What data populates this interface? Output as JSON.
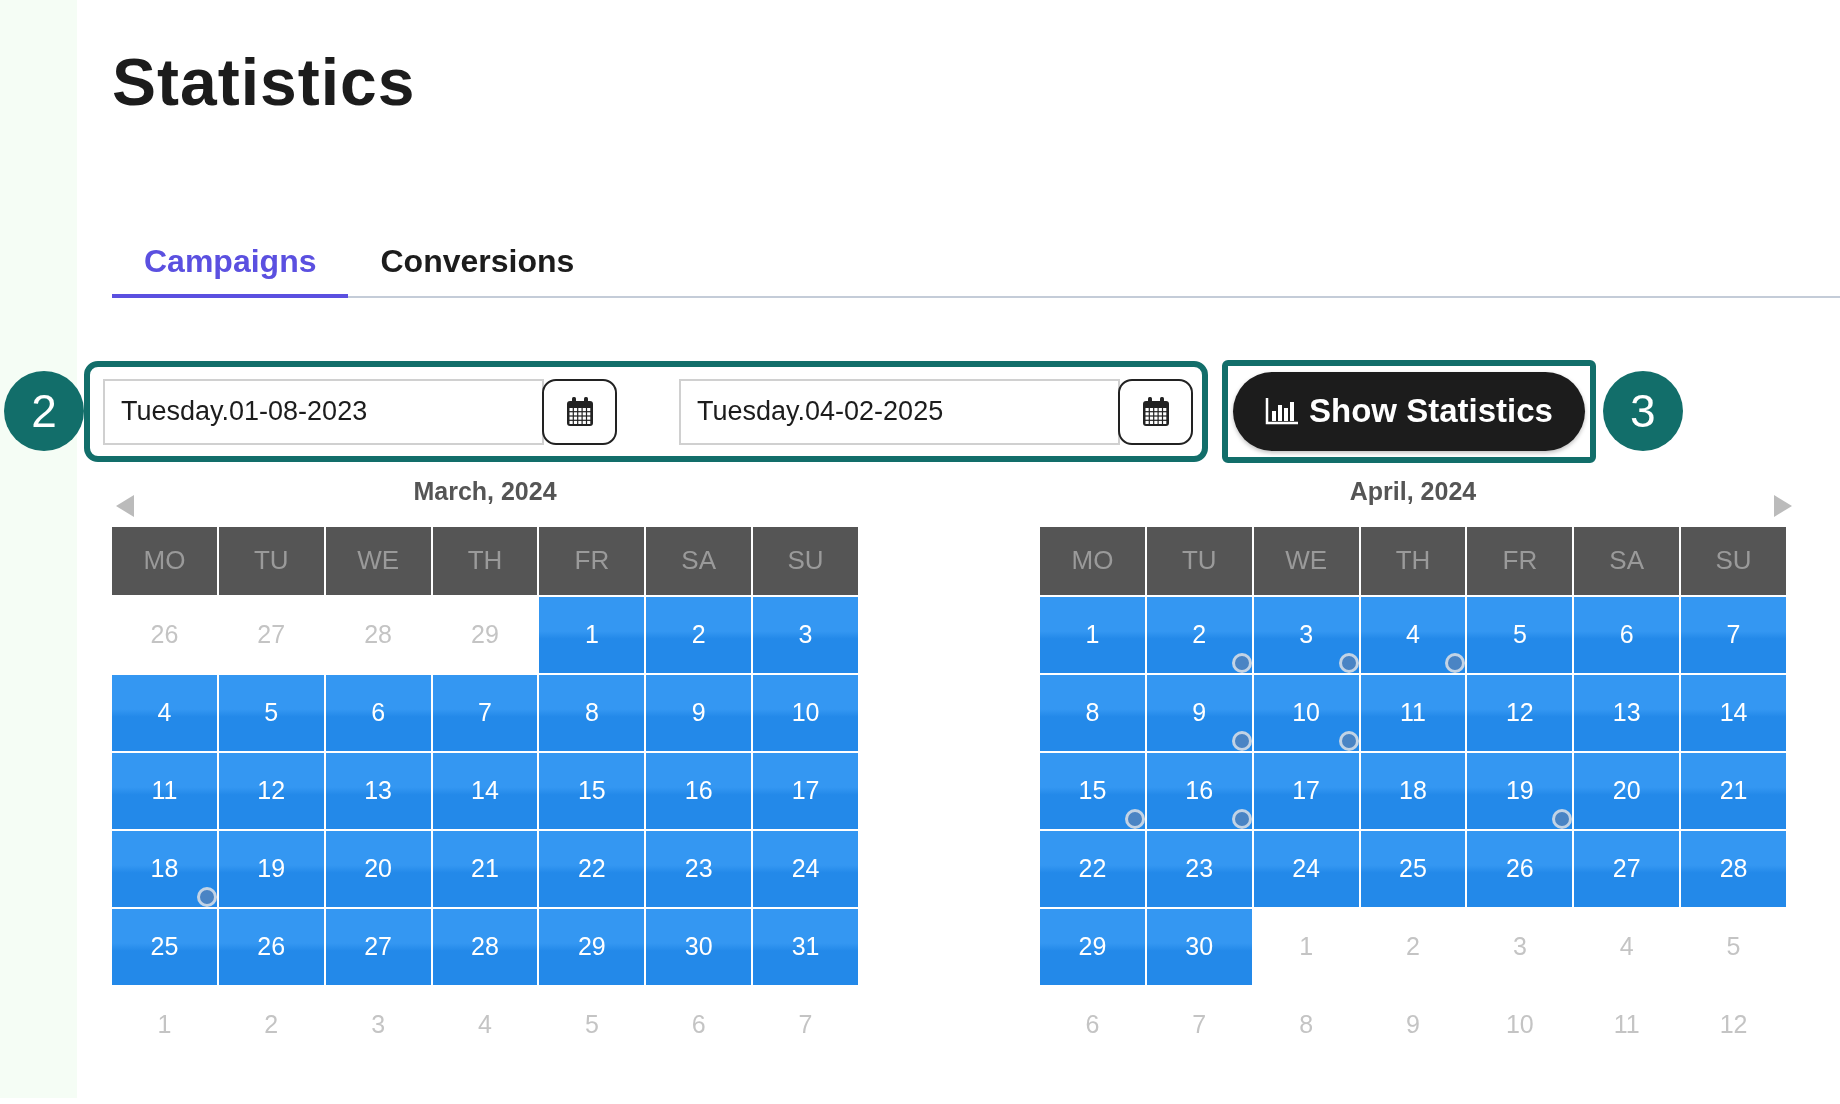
{
  "title": "Statistics",
  "tabs": [
    {
      "label": "Campaigns",
      "selected": true
    },
    {
      "label": "Conversions",
      "selected": false
    }
  ],
  "callouts": [
    "2",
    "3"
  ],
  "date_range": {
    "start": "Tuesday.01-08-2023",
    "end": "Tuesday.04-02-2025"
  },
  "show_button": "Show Statistics",
  "months": [
    {
      "title": "March, 2024",
      "prev_arrow": true,
      "next_arrow": false,
      "weekdays": [
        "MO",
        "TU",
        "WE",
        "TH",
        "FR",
        "SA",
        "SU"
      ],
      "weeks": [
        [
          {
            "label": "26",
            "selected": false,
            "marked": false
          },
          {
            "label": "27",
            "selected": false,
            "marked": false
          },
          {
            "label": "28",
            "selected": false,
            "marked": false
          },
          {
            "label": "29",
            "selected": false,
            "marked": false
          },
          {
            "label": "1",
            "selected": true,
            "marked": false
          },
          {
            "label": "2",
            "selected": true,
            "marked": false
          },
          {
            "label": "3",
            "selected": true,
            "marked": false
          }
        ],
        [
          {
            "label": "4",
            "selected": true,
            "marked": false
          },
          {
            "label": "5",
            "selected": true,
            "marked": false
          },
          {
            "label": "6",
            "selected": true,
            "marked": false
          },
          {
            "label": "7",
            "selected": true,
            "marked": false
          },
          {
            "label": "8",
            "selected": true,
            "marked": false
          },
          {
            "label": "9",
            "selected": true,
            "marked": false
          },
          {
            "label": "10",
            "selected": true,
            "marked": false
          }
        ],
        [
          {
            "label": "11",
            "selected": true,
            "marked": false
          },
          {
            "label": "12",
            "selected": true,
            "marked": false
          },
          {
            "label": "13",
            "selected": true,
            "marked": false
          },
          {
            "label": "14",
            "selected": true,
            "marked": false
          },
          {
            "label": "15",
            "selected": true,
            "marked": false
          },
          {
            "label": "16",
            "selected": true,
            "marked": false
          },
          {
            "label": "17",
            "selected": true,
            "marked": false
          }
        ],
        [
          {
            "label": "18",
            "selected": true,
            "marked": true
          },
          {
            "label": "19",
            "selected": true,
            "marked": false
          },
          {
            "label": "20",
            "selected": true,
            "marked": false
          },
          {
            "label": "21",
            "selected": true,
            "marked": false
          },
          {
            "label": "22",
            "selected": true,
            "marked": false
          },
          {
            "label": "23",
            "selected": true,
            "marked": false
          },
          {
            "label": "24",
            "selected": true,
            "marked": false
          }
        ],
        [
          {
            "label": "25",
            "selected": true,
            "marked": false
          },
          {
            "label": "26",
            "selected": true,
            "marked": false
          },
          {
            "label": "27",
            "selected": true,
            "marked": false
          },
          {
            "label": "28",
            "selected": true,
            "marked": false
          },
          {
            "label": "29",
            "selected": true,
            "marked": false
          },
          {
            "label": "30",
            "selected": true,
            "marked": false
          },
          {
            "label": "31",
            "selected": true,
            "marked": false
          }
        ],
        [
          {
            "label": "1",
            "selected": false,
            "marked": false
          },
          {
            "label": "2",
            "selected": false,
            "marked": false
          },
          {
            "label": "3",
            "selected": false,
            "marked": false
          },
          {
            "label": "4",
            "selected": false,
            "marked": false
          },
          {
            "label": "5",
            "selected": false,
            "marked": false
          },
          {
            "label": "6",
            "selected": false,
            "marked": false
          },
          {
            "label": "7",
            "selected": false,
            "marked": false
          }
        ]
      ]
    },
    {
      "title": "April, 2024",
      "prev_arrow": false,
      "next_arrow": true,
      "weekdays": [
        "MO",
        "TU",
        "WE",
        "TH",
        "FR",
        "SA",
        "SU"
      ],
      "weeks": [
        [
          {
            "label": "1",
            "selected": true,
            "marked": false
          },
          {
            "label": "2",
            "selected": true,
            "marked": true
          },
          {
            "label": "3",
            "selected": true,
            "marked": true
          },
          {
            "label": "4",
            "selected": true,
            "marked": true
          },
          {
            "label": "5",
            "selected": true,
            "marked": false
          },
          {
            "label": "6",
            "selected": true,
            "marked": false
          },
          {
            "label": "7",
            "selected": true,
            "marked": false
          }
        ],
        [
          {
            "label": "8",
            "selected": true,
            "marked": false
          },
          {
            "label": "9",
            "selected": true,
            "marked": true
          },
          {
            "label": "10",
            "selected": true,
            "marked": true
          },
          {
            "label": "11",
            "selected": true,
            "marked": false
          },
          {
            "label": "12",
            "selected": true,
            "marked": false
          },
          {
            "label": "13",
            "selected": true,
            "marked": false
          },
          {
            "label": "14",
            "selected": true,
            "marked": false
          }
        ],
        [
          {
            "label": "15",
            "selected": true,
            "marked": true
          },
          {
            "label": "16",
            "selected": true,
            "marked": true
          },
          {
            "label": "17",
            "selected": true,
            "marked": false
          },
          {
            "label": "18",
            "selected": true,
            "marked": false
          },
          {
            "label": "19",
            "selected": true,
            "marked": true
          },
          {
            "label": "20",
            "selected": true,
            "marked": false
          },
          {
            "label": "21",
            "selected": true,
            "marked": false
          }
        ],
        [
          {
            "label": "22",
            "selected": true,
            "marked": false
          },
          {
            "label": "23",
            "selected": true,
            "marked": false
          },
          {
            "label": "24",
            "selected": true,
            "marked": false
          },
          {
            "label": "25",
            "selected": true,
            "marked": false
          },
          {
            "label": "26",
            "selected": true,
            "marked": false
          },
          {
            "label": "27",
            "selected": true,
            "marked": false
          },
          {
            "label": "28",
            "selected": true,
            "marked": false
          }
        ],
        [
          {
            "label": "29",
            "selected": true,
            "marked": false
          },
          {
            "label": "30",
            "selected": true,
            "marked": false
          },
          {
            "label": "1",
            "selected": false,
            "marked": false
          },
          {
            "label": "2",
            "selected": false,
            "marked": false
          },
          {
            "label": "3",
            "selected": false,
            "marked": false
          },
          {
            "label": "4",
            "selected": false,
            "marked": false
          },
          {
            "label": "5",
            "selected": false,
            "marked": false
          }
        ],
        [
          {
            "label": "6",
            "selected": false,
            "marked": false
          },
          {
            "label": "7",
            "selected": false,
            "marked": false
          },
          {
            "label": "8",
            "selected": false,
            "marked": false
          },
          {
            "label": "9",
            "selected": false,
            "marked": false
          },
          {
            "label": "10",
            "selected": false,
            "marked": false
          },
          {
            "label": "11",
            "selected": false,
            "marked": false
          },
          {
            "label": "12",
            "selected": false,
            "marked": false
          }
        ]
      ]
    }
  ]
}
